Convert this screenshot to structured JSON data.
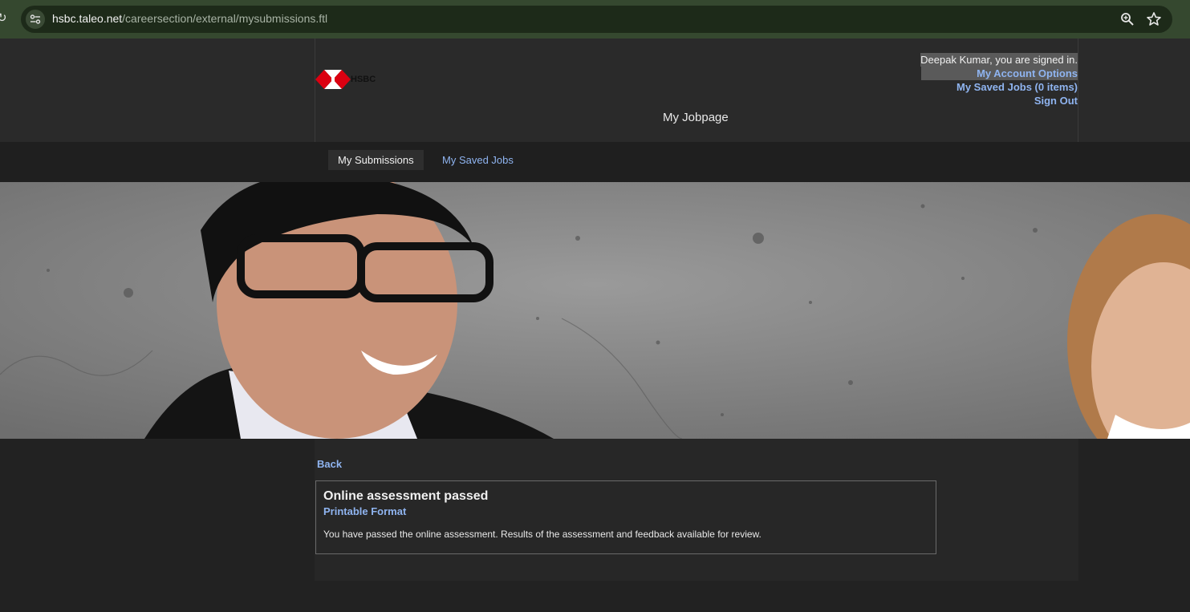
{
  "browser": {
    "url_host": "hsbc.taleo.net",
    "url_path": "/careersection/external/mysubmissions.ftl"
  },
  "header": {
    "logo_text": "HSBC",
    "signed_in_text": "Deepak Kumar, you are signed in.",
    "account_options": "My Account Options",
    "saved_jobs_link": "My Saved Jobs (0 items)",
    "sign_out": "Sign Out",
    "page_title": "My Jobpage"
  },
  "tabs": [
    {
      "label": "My Submissions",
      "active": true
    },
    {
      "label": "My Saved Jobs",
      "active": false
    }
  ],
  "content": {
    "back_label": "Back",
    "message_title": "Online assessment passed",
    "printable_label": "Printable Format",
    "message_body": "You have passed the online assessment. Results of the assessment and feedback available for review."
  },
  "icons": {
    "reload": "reload-icon",
    "site_info": "tune-icon",
    "zoom": "zoom-icon",
    "bookmark": "star-icon"
  },
  "colors": {
    "link": "#8fb4f0",
    "browser_frame": "#35482f",
    "page_bg": "#222222",
    "brand_red": "#db0011"
  }
}
